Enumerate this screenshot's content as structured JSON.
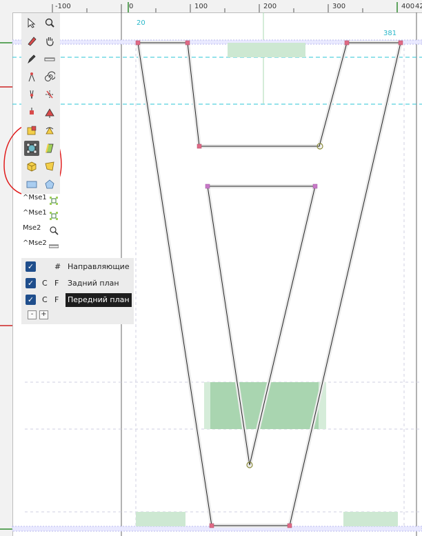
{
  "ruler": {
    "ticks": [
      "-100",
      "0",
      "100",
      "200",
      "300",
      "400",
      "42"
    ]
  },
  "canvas": {
    "guide_labels": [
      "20",
      "381"
    ]
  },
  "toolbox": {
    "tools": [
      {
        "name": "select-tool-icon"
      },
      {
        "name": "zoom-tool-icon"
      },
      {
        "name": "pencil-tool-icon"
      },
      {
        "name": "hand-tool-icon"
      },
      {
        "name": "pen-tool-icon"
      },
      {
        "name": "measure-tool-icon"
      },
      {
        "name": "add-point-tool-icon"
      },
      {
        "name": "spiral-tool-icon"
      },
      {
        "name": "curve-point-tool-icon"
      },
      {
        "name": "corner-point-tool-icon"
      },
      {
        "name": "tangent-tool-icon"
      },
      {
        "name": "triangle-tool-icon"
      },
      {
        "name": "scale-tool-icon"
      },
      {
        "name": "rotate-tool-icon"
      },
      {
        "name": "transform-tool-icon"
      },
      {
        "name": "skew-tool-icon"
      },
      {
        "name": "3d-tool-icon"
      },
      {
        "name": "perspective-tool-icon"
      },
      {
        "name": "rectangle-tool-icon"
      },
      {
        "name": "polygon-tool-icon"
      }
    ],
    "active_tool": "transform-tool-icon"
  },
  "snaps": {
    "rows": [
      "^Mse1",
      "^Mse1",
      "Mse2",
      "^Mse2"
    ]
  },
  "layers": {
    "rows": [
      {
        "check": "✓",
        "flag1": "",
        "flag2": "#",
        "name": "Направляющие",
        "selected": false
      },
      {
        "check": "✓",
        "flag1": "C",
        "flag2": "F",
        "name": "Задний план",
        "selected": false
      },
      {
        "check": "✓",
        "flag1": "C",
        "flag2": "F",
        "name": "Передний план",
        "selected": true
      }
    ],
    "minus_label": "-",
    "plus_label": "+"
  }
}
